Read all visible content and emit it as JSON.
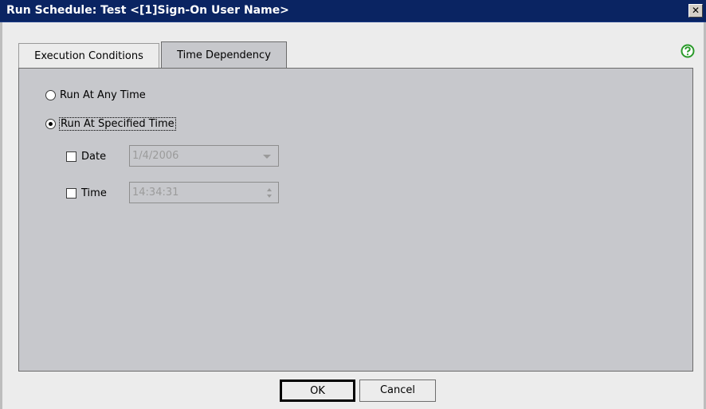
{
  "window": {
    "title": "Run Schedule: Test <[1]Sign-On User Name>",
    "close_glyph": "✕"
  },
  "tabs": [
    {
      "label": "Execution Conditions",
      "active": false
    },
    {
      "label": "Time Dependency",
      "active": true
    }
  ],
  "help_icon": "help-icon",
  "run_options": [
    {
      "label": "Run At Any Time",
      "selected": false
    },
    {
      "label": "Run At Specified Time",
      "selected": true
    }
  ],
  "date": {
    "label": "Date",
    "checked": false,
    "value": "1/4/2006"
  },
  "time": {
    "label": "Time",
    "checked": false,
    "value": "14:34:31"
  },
  "buttons": {
    "ok": "OK",
    "cancel": "Cancel"
  },
  "colors": {
    "titlebar": "#0a2462",
    "panel": "#c7c8cc",
    "help": "#2a9a2a"
  }
}
